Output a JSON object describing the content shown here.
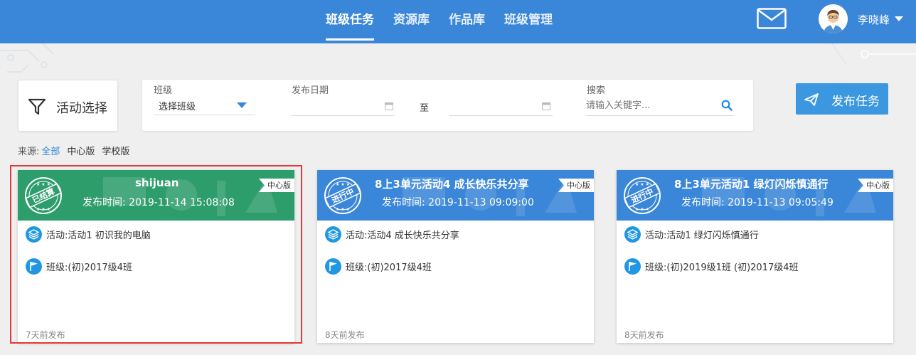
{
  "nav": {
    "items": [
      {
        "label": "班级任务",
        "active": true
      },
      {
        "label": "资源库",
        "active": false
      },
      {
        "label": "作品库",
        "active": false
      },
      {
        "label": "班级管理",
        "active": false
      }
    ]
  },
  "user": {
    "name": "李晓峰"
  },
  "activity_select": {
    "label": "活动选择"
  },
  "filters": {
    "class_label": "班级",
    "class_value": "选择班级",
    "date_label": "发布日期",
    "to_label": "至",
    "search_label": "搜索",
    "search_placeholder": "请输入关键字..."
  },
  "publish_button": {
    "label": "发布任务"
  },
  "source": {
    "label": "来源:",
    "options": [
      {
        "label": "全部",
        "active": true
      },
      {
        "label": "中心版",
        "active": false
      },
      {
        "label": "学校版",
        "active": false
      }
    ]
  },
  "colors": {
    "primary": "#3a86d8",
    "done_green": "#2e9d6c",
    "highlight_red": "#e53935"
  },
  "cards": [
    {
      "status": "已结算",
      "title": "shijuan",
      "time_label": "发布时间:",
      "time": "2019-11-14 15:08:08",
      "badge": "中心版",
      "activity_label": "活动:",
      "activity": "活动1 初识我的电脑",
      "class_label": "班级:",
      "classes": "(初)2017级4班",
      "footer": "7天前发布",
      "selected": true
    },
    {
      "status": "进行中",
      "title": "8上3单元活动4 成长快乐共分享",
      "time_label": "发布时间:",
      "time": "2019-11-13 09:09:00",
      "badge": "中心版",
      "activity_label": "活动:",
      "activity": "活动4 成长快乐共分享",
      "class_label": "班级:",
      "classes": "(初)2017级4班",
      "footer": "8天前发布",
      "selected": false
    },
    {
      "status": "进行中",
      "title": "8上3单元活动1 绿灯闪烁慎通行",
      "time_label": "发布时间:",
      "time": "2019-11-13 09:05:49",
      "badge": "中心版",
      "activity_label": "活动:",
      "activity": "活动1 绿灯闪烁慎通行",
      "class_label": "班级:",
      "classes": "(初)2019级1班 (初)2017级4班",
      "footer": "8天前发布",
      "selected": false
    }
  ]
}
